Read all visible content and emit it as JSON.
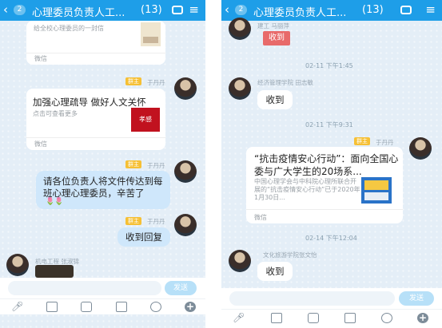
{
  "left": {
    "header": {
      "back": "‹",
      "badge": "2",
      "title": "心理委员负责人工...",
      "count": "(13)",
      "menu": "≡"
    },
    "card1": {
      "desc": "给全校心理委员的一封信",
      "footer": "微信"
    },
    "sender1": {
      "role": "群主",
      "name": "于丹丹"
    },
    "card2": {
      "title": "加强心理疏导 做好人文关怀",
      "desc": "点击可查看更多",
      "footer": "微信",
      "thumb_text": "孝感"
    },
    "sender2": {
      "role": "群主",
      "name": "于丹丹"
    },
    "msg1": {
      "text": "请各位负责人将文件传达到每班心理心理委员，辛苦了",
      "flowers": "🌷🌷"
    },
    "sender3": {
      "role": "群主",
      "name": "于丹丹"
    },
    "msg2": {
      "text": "收到回复"
    },
    "sender4": {
      "name": "机电工程 张淑锦"
    },
    "input": {
      "send": "发送"
    }
  },
  "right": {
    "header": {
      "back": "‹",
      "badge": "2",
      "title": "心理委员负责人工...",
      "count": "(13)",
      "menu": "≡"
    },
    "top_sender": {
      "name": "建工 马丽萍"
    },
    "sticker": {
      "text": "收到"
    },
    "ts1": "02-11 下午1:45",
    "sender_a": {
      "name": "经济管理学院 田志敏"
    },
    "msg_a": {
      "text": "收到"
    },
    "ts2": "02-11 下午9:31",
    "sender_b": {
      "role": "群主",
      "name": "于丹丹"
    },
    "card": {
      "title": "“抗击疫情安心行动”：面向全国心委与广大学生的20场系...",
      "desc": "中国心理学会与中科院心理所联合开展的“抗击疫情安心行动”已于2020年1月30日...",
      "footer": "微信"
    },
    "ts3": "02-14 下午12:04",
    "sender_c": {
      "name": "文化旅游学院张文怡"
    },
    "msg_c": {
      "text": "收到"
    },
    "input": {
      "send": "发送"
    }
  },
  "colors": {
    "topbar": "#1e9ee8",
    "bubble": "#cfe7fb",
    "role_badge": "#f6c035",
    "send": "#b7e0f8"
  },
  "icons": [
    "mic-icon",
    "image-icon",
    "camera-icon",
    "redpacket-icon",
    "emoji-icon",
    "plus-icon"
  ]
}
